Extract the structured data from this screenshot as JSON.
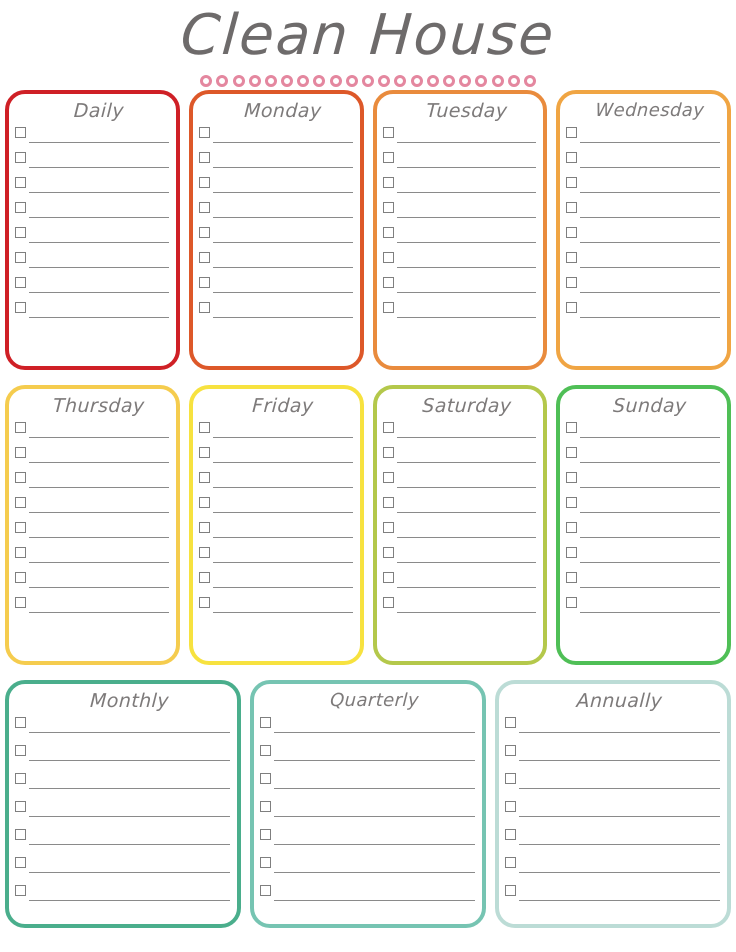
{
  "header": {
    "title": "Clean House",
    "dot_count": 21,
    "dot_color": "#e4879f"
  },
  "theme": {
    "page_background": "#ffffff",
    "title_color": "#6e6b6b",
    "card_title_color": "#7d7a7a",
    "checkbox_border": "#7f7f7f",
    "writeline_color": "#8a8a8a"
  },
  "sections": [
    {
      "name": "weekday-row-1",
      "rows_per_card": 8,
      "cards": [
        {
          "label": "Daily",
          "color": "#cf2026"
        },
        {
          "label": "Monday",
          "color": "#dd5829"
        },
        {
          "label": "Tuesday",
          "color": "#e98b3d"
        },
        {
          "label": "Wednesday",
          "color": "#f0a543"
        }
      ]
    },
    {
      "name": "weekday-row-2",
      "rows_per_card": 8,
      "cards": [
        {
          "label": "Thursday",
          "color": "#f5cc4e"
        },
        {
          "label": "Friday",
          "color": "#f7e košice"
        },
        {
          "label": "Saturday",
          "color": "#b4c84b"
        },
        {
          "label": "Sunday",
          "color": "#4fbf56"
        }
      ]
    },
    {
      "name": "periodic-row",
      "rows_per_card": 7,
      "cards": [
        {
          "label": "Monthly",
          "color": "#4aae8c"
        },
        {
          "label": "Quarterly",
          "color": "#76c4b2"
        },
        {
          "label": "Annually",
          "color": "#bcdcd6"
        }
      ]
    }
  ]
}
